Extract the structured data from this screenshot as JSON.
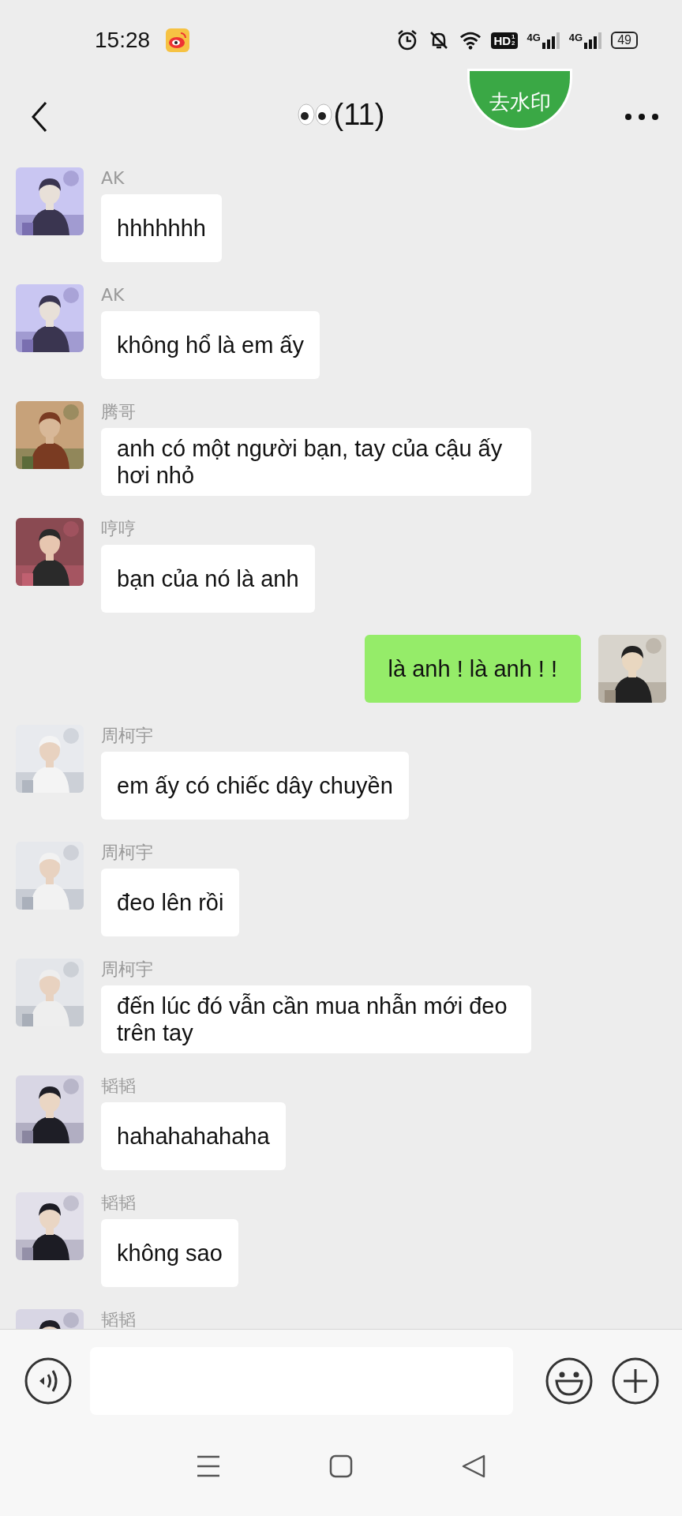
{
  "status_bar": {
    "time": "15:28",
    "hd_badge": {
      "label": "HD",
      "fraction": [
        "1",
        "2"
      ]
    },
    "networks": [
      {
        "label": "4G"
      },
      {
        "label": "4G"
      }
    ],
    "battery": "49"
  },
  "header": {
    "title": "(11)",
    "watermark_button": "去水印"
  },
  "messages": [
    {
      "kind": "incoming",
      "sender": "AK",
      "text": "hhhhhhh"
    },
    {
      "kind": "incoming",
      "sender": "AK",
      "text": "không hổ là em ấy"
    },
    {
      "kind": "incoming",
      "sender": "腾哥",
      "text": "anh có một người bạn, tay của cậu ấy hơi nhỏ"
    },
    {
      "kind": "incoming",
      "sender": "哼哼",
      "text": "bạn của nó là anh"
    },
    {
      "kind": "outgoing",
      "text": "là anh ! là anh ! !"
    },
    {
      "kind": "incoming",
      "sender": "周柯宇",
      "text": "em ấy có chiếc dây chuyền"
    },
    {
      "kind": "incoming",
      "sender": "周柯宇",
      "text": "đeo lên rồi"
    },
    {
      "kind": "incoming",
      "sender": "周柯宇",
      "text": "đến lúc đó vẫn cần mua nhẫn mới đeo trên tay"
    },
    {
      "kind": "incoming",
      "sender": "韬韬",
      "text": "hahahahahaha"
    },
    {
      "kind": "incoming",
      "sender": "韬韬",
      "text": "không sao"
    },
    {
      "kind": "incoming",
      "sender": "韬韬"
    }
  ]
}
